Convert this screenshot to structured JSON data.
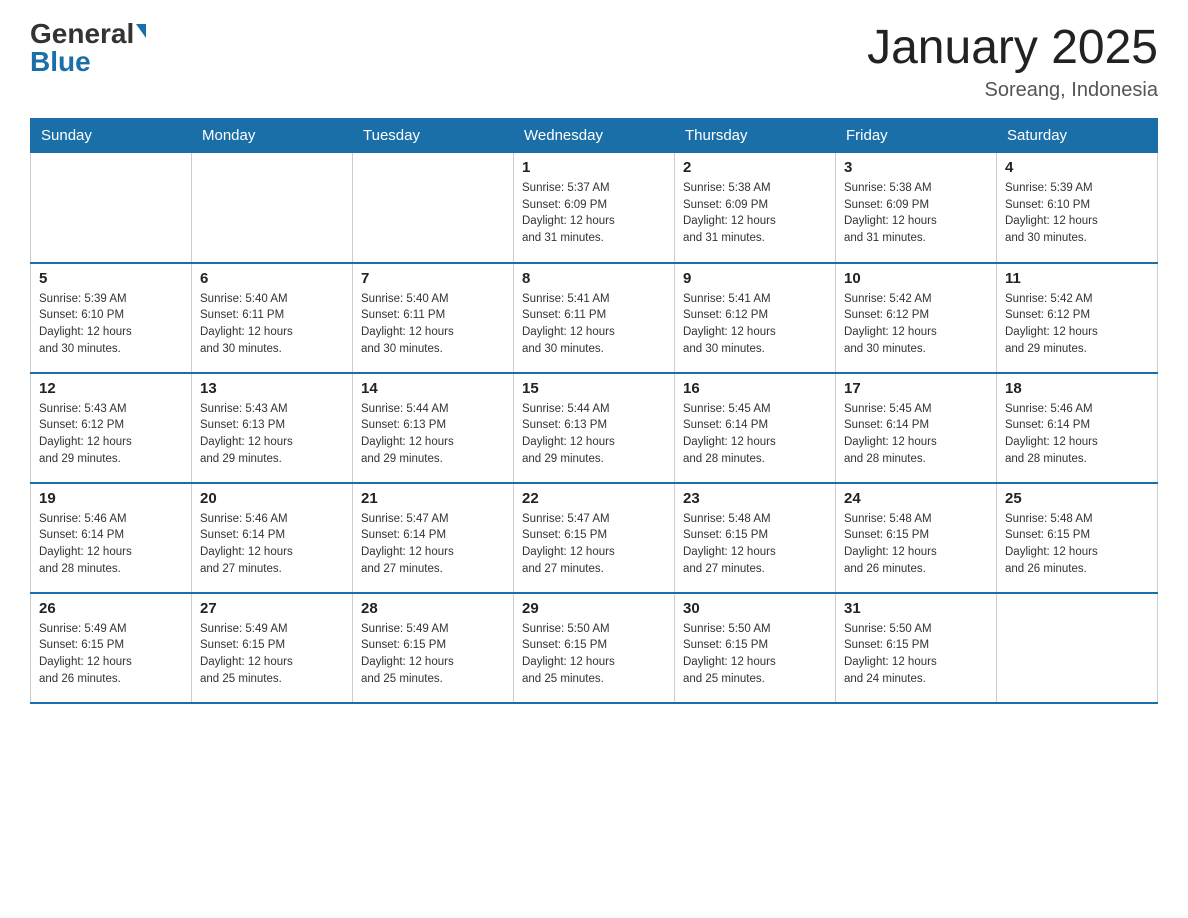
{
  "logo": {
    "general": "General",
    "blue": "Blue"
  },
  "title": "January 2025",
  "subtitle": "Soreang, Indonesia",
  "days_of_week": [
    "Sunday",
    "Monday",
    "Tuesday",
    "Wednesday",
    "Thursday",
    "Friday",
    "Saturday"
  ],
  "weeks": [
    [
      {
        "day": "",
        "info": ""
      },
      {
        "day": "",
        "info": ""
      },
      {
        "day": "",
        "info": ""
      },
      {
        "day": "1",
        "info": "Sunrise: 5:37 AM\nSunset: 6:09 PM\nDaylight: 12 hours\nand 31 minutes."
      },
      {
        "day": "2",
        "info": "Sunrise: 5:38 AM\nSunset: 6:09 PM\nDaylight: 12 hours\nand 31 minutes."
      },
      {
        "day": "3",
        "info": "Sunrise: 5:38 AM\nSunset: 6:09 PM\nDaylight: 12 hours\nand 31 minutes."
      },
      {
        "day": "4",
        "info": "Sunrise: 5:39 AM\nSunset: 6:10 PM\nDaylight: 12 hours\nand 30 minutes."
      }
    ],
    [
      {
        "day": "5",
        "info": "Sunrise: 5:39 AM\nSunset: 6:10 PM\nDaylight: 12 hours\nand 30 minutes."
      },
      {
        "day": "6",
        "info": "Sunrise: 5:40 AM\nSunset: 6:11 PM\nDaylight: 12 hours\nand 30 minutes."
      },
      {
        "day": "7",
        "info": "Sunrise: 5:40 AM\nSunset: 6:11 PM\nDaylight: 12 hours\nand 30 minutes."
      },
      {
        "day": "8",
        "info": "Sunrise: 5:41 AM\nSunset: 6:11 PM\nDaylight: 12 hours\nand 30 minutes."
      },
      {
        "day": "9",
        "info": "Sunrise: 5:41 AM\nSunset: 6:12 PM\nDaylight: 12 hours\nand 30 minutes."
      },
      {
        "day": "10",
        "info": "Sunrise: 5:42 AM\nSunset: 6:12 PM\nDaylight: 12 hours\nand 30 minutes."
      },
      {
        "day": "11",
        "info": "Sunrise: 5:42 AM\nSunset: 6:12 PM\nDaylight: 12 hours\nand 29 minutes."
      }
    ],
    [
      {
        "day": "12",
        "info": "Sunrise: 5:43 AM\nSunset: 6:12 PM\nDaylight: 12 hours\nand 29 minutes."
      },
      {
        "day": "13",
        "info": "Sunrise: 5:43 AM\nSunset: 6:13 PM\nDaylight: 12 hours\nand 29 minutes."
      },
      {
        "day": "14",
        "info": "Sunrise: 5:44 AM\nSunset: 6:13 PM\nDaylight: 12 hours\nand 29 minutes."
      },
      {
        "day": "15",
        "info": "Sunrise: 5:44 AM\nSunset: 6:13 PM\nDaylight: 12 hours\nand 29 minutes."
      },
      {
        "day": "16",
        "info": "Sunrise: 5:45 AM\nSunset: 6:14 PM\nDaylight: 12 hours\nand 28 minutes."
      },
      {
        "day": "17",
        "info": "Sunrise: 5:45 AM\nSunset: 6:14 PM\nDaylight: 12 hours\nand 28 minutes."
      },
      {
        "day": "18",
        "info": "Sunrise: 5:46 AM\nSunset: 6:14 PM\nDaylight: 12 hours\nand 28 minutes."
      }
    ],
    [
      {
        "day": "19",
        "info": "Sunrise: 5:46 AM\nSunset: 6:14 PM\nDaylight: 12 hours\nand 28 minutes."
      },
      {
        "day": "20",
        "info": "Sunrise: 5:46 AM\nSunset: 6:14 PM\nDaylight: 12 hours\nand 27 minutes."
      },
      {
        "day": "21",
        "info": "Sunrise: 5:47 AM\nSunset: 6:14 PM\nDaylight: 12 hours\nand 27 minutes."
      },
      {
        "day": "22",
        "info": "Sunrise: 5:47 AM\nSunset: 6:15 PM\nDaylight: 12 hours\nand 27 minutes."
      },
      {
        "day": "23",
        "info": "Sunrise: 5:48 AM\nSunset: 6:15 PM\nDaylight: 12 hours\nand 27 minutes."
      },
      {
        "day": "24",
        "info": "Sunrise: 5:48 AM\nSunset: 6:15 PM\nDaylight: 12 hours\nand 26 minutes."
      },
      {
        "day": "25",
        "info": "Sunrise: 5:48 AM\nSunset: 6:15 PM\nDaylight: 12 hours\nand 26 minutes."
      }
    ],
    [
      {
        "day": "26",
        "info": "Sunrise: 5:49 AM\nSunset: 6:15 PM\nDaylight: 12 hours\nand 26 minutes."
      },
      {
        "day": "27",
        "info": "Sunrise: 5:49 AM\nSunset: 6:15 PM\nDaylight: 12 hours\nand 25 minutes."
      },
      {
        "day": "28",
        "info": "Sunrise: 5:49 AM\nSunset: 6:15 PM\nDaylight: 12 hours\nand 25 minutes."
      },
      {
        "day": "29",
        "info": "Sunrise: 5:50 AM\nSunset: 6:15 PM\nDaylight: 12 hours\nand 25 minutes."
      },
      {
        "day": "30",
        "info": "Sunrise: 5:50 AM\nSunset: 6:15 PM\nDaylight: 12 hours\nand 25 minutes."
      },
      {
        "day": "31",
        "info": "Sunrise: 5:50 AM\nSunset: 6:15 PM\nDaylight: 12 hours\nand 24 minutes."
      },
      {
        "day": "",
        "info": ""
      }
    ]
  ]
}
